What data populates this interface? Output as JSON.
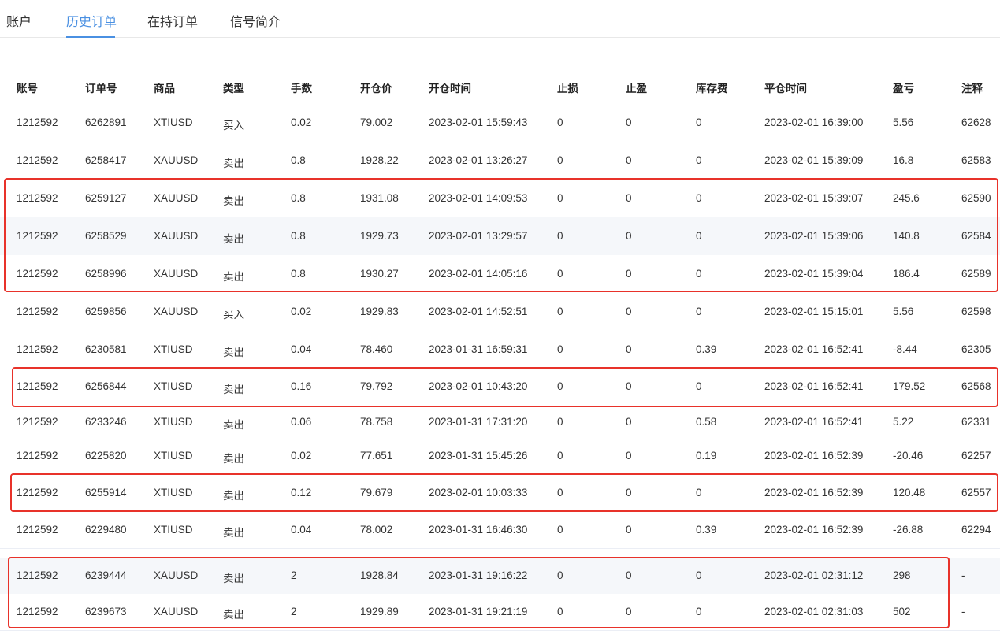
{
  "tabs": [
    {
      "label": "账户",
      "active": false
    },
    {
      "label": "历史订单",
      "active": true
    },
    {
      "label": "在持订单",
      "active": false
    },
    {
      "label": "信号简介",
      "active": false
    }
  ],
  "accent_color": "#4a90e2",
  "highlight_color": "#e8322a",
  "table": {
    "headers": [
      "账号",
      "订单号",
      "商品",
      "类型",
      "手数",
      "开仓价",
      "开仓时间",
      "止损",
      "止盈",
      "库存费",
      "平仓时间",
      "盈亏",
      "注释"
    ],
    "rows": [
      [
        "1212592",
        "6262891",
        "XTIUSD",
        "买入",
        "0.02",
        "79.002",
        "2023-02-01 15:59:43",
        "0",
        "0",
        "0",
        "2023-02-01 16:39:00",
        "5.56",
        "62628"
      ],
      [
        "1212592",
        "6258417",
        "XAUUSD",
        "卖出",
        "0.8",
        "1928.22",
        "2023-02-01 13:26:27",
        "0",
        "0",
        "0",
        "2023-02-01 15:39:09",
        "16.8",
        "62583"
      ],
      [
        "1212592",
        "6259127",
        "XAUUSD",
        "卖出",
        "0.8",
        "1931.08",
        "2023-02-01 14:09:53",
        "0",
        "0",
        "0",
        "2023-02-01 15:39:07",
        "245.6",
        "62590"
      ],
      [
        "1212592",
        "6258529",
        "XAUUSD",
        "卖出",
        "0.8",
        "1929.73",
        "2023-02-01 13:29:57",
        "0",
        "0",
        "0",
        "2023-02-01 15:39:06",
        "140.8",
        "62584"
      ],
      [
        "1212592",
        "6258996",
        "XAUUSD",
        "卖出",
        "0.8",
        "1930.27",
        "2023-02-01 14:05:16",
        "0",
        "0",
        "0",
        "2023-02-01 15:39:04",
        "186.4",
        "62589"
      ],
      [
        "1212592",
        "6259856",
        "XAUUSD",
        "买入",
        "0.02",
        "1929.83",
        "2023-02-01 14:52:51",
        "0",
        "0",
        "0",
        "2023-02-01 15:15:01",
        "5.56",
        "62598"
      ],
      [
        "1212592",
        "6230581",
        "XTIUSD",
        "卖出",
        "0.04",
        "78.460",
        "2023-01-31 16:59:31",
        "0",
        "0",
        "0.39",
        "2023-02-01 16:52:41",
        "-8.44",
        "62305"
      ],
      [
        "1212592",
        "6256844",
        "XTIUSD",
        "卖出",
        "0.16",
        "79.792",
        "2023-02-01 10:43:20",
        "0",
        "0",
        "0",
        "2023-02-01 16:52:41",
        "179.52",
        "62568"
      ],
      [
        "1212592",
        "6233246",
        "XTIUSD",
        "卖出",
        "0.06",
        "78.758",
        "2023-01-31 17:31:20",
        "0",
        "0",
        "0.58",
        "2023-02-01 16:52:41",
        "5.22",
        "62331"
      ],
      [
        "1212592",
        "6225820",
        "XTIUSD",
        "卖出",
        "0.02",
        "77.651",
        "2023-01-31 15:45:26",
        "0",
        "0",
        "0.19",
        "2023-02-01 16:52:39",
        "-20.46",
        "62257"
      ],
      [
        "1212592",
        "6255914",
        "XTIUSD",
        "卖出",
        "0.12",
        "79.679",
        "2023-02-01 10:03:33",
        "0",
        "0",
        "0",
        "2023-02-01 16:52:39",
        "120.48",
        "62557"
      ],
      [
        "1212592",
        "6229480",
        "XTIUSD",
        "卖出",
        "0.04",
        "78.002",
        "2023-01-31 16:46:30",
        "0",
        "0",
        "0.39",
        "2023-02-01 16:52:39",
        "-26.88",
        "62294"
      ],
      [
        "1212592",
        "6239444",
        "XAUUSD",
        "卖出",
        "2",
        "1928.84",
        "2023-01-31 19:16:22",
        "0",
        "0",
        "0",
        "2023-02-01 02:31:12",
        "298",
        "-"
      ],
      [
        "1212592",
        "6239673",
        "XAUUSD",
        "卖出",
        "2",
        "1929.89",
        "2023-01-31 19:21:19",
        "0",
        "0",
        "0",
        "2023-02-01 02:31:03",
        "502",
        "-"
      ]
    ]
  }
}
